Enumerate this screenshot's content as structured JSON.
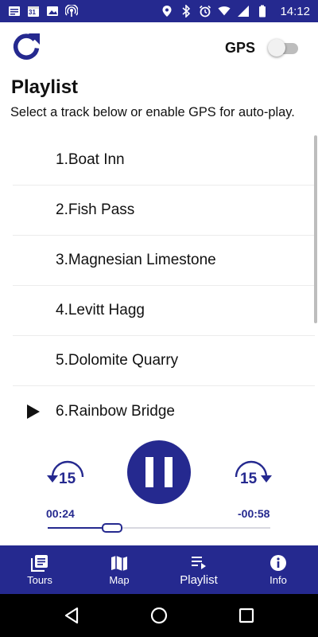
{
  "status_bar": {
    "time": "14:12",
    "calendar_date": "31",
    "left_icons": [
      "message-icon",
      "calendar-icon",
      "image-icon",
      "hotspot-icon"
    ],
    "right_icons": [
      "location-icon",
      "bluetooth-icon",
      "alarm-icon",
      "wifi-icon",
      "signal-icon",
      "battery-icon"
    ]
  },
  "header": {
    "gps_label": "GPS",
    "gps_enabled": false
  },
  "page": {
    "title": "Playlist",
    "subtitle": "Select a track below or enable GPS for auto-play."
  },
  "playlist": {
    "tracks": [
      {
        "label": "1.Boat Inn"
      },
      {
        "label": "2.Fish Pass"
      },
      {
        "label": "3.Magnesian Limestone"
      },
      {
        "label": "4.Levitt Hagg"
      },
      {
        "label": "5.Dolomite Quarry"
      },
      {
        "label": "6.Rainbow Bridge"
      }
    ],
    "active_index": 5
  },
  "player": {
    "skip_back_seconds": "15",
    "skip_forward_seconds": "15",
    "elapsed": "00:24",
    "remaining": "-00:58",
    "progress_fraction": 0.29,
    "state": "playing"
  },
  "bottom_nav": {
    "items": [
      {
        "label": "Tours",
        "icon": "tours-icon"
      },
      {
        "label": "Map",
        "icon": "map-icon"
      },
      {
        "label": "Playlist",
        "icon": "playlist-icon"
      },
      {
        "label": "Info",
        "icon": "info-icon"
      }
    ],
    "active_index": 2
  },
  "colors": {
    "accent": "#25298f",
    "status_bar": "#25298f",
    "system_nav": "#000000"
  }
}
